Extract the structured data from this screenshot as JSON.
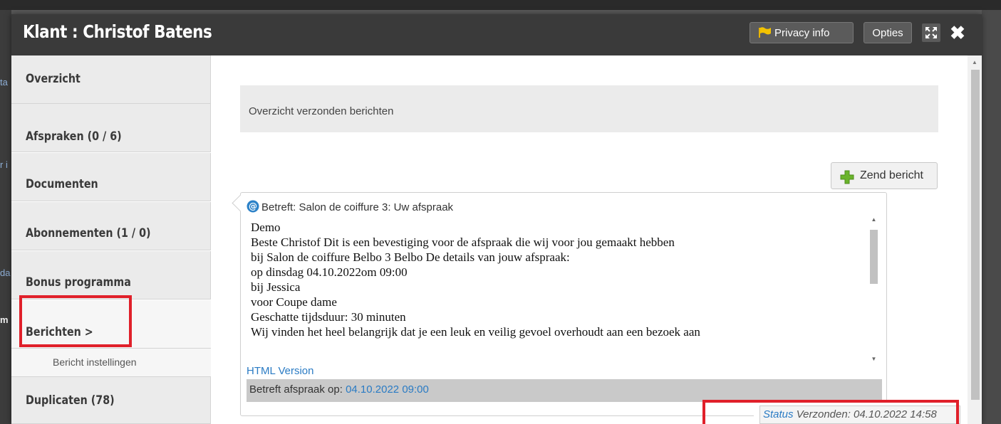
{
  "background": {
    "fragments": [
      "ta",
      "r i",
      "da",
      "m"
    ]
  },
  "modal": {
    "title": "Klant : Christof Batens",
    "privacy_label": "Privacy info",
    "options_label": "Opties",
    "close_glyph": "✖"
  },
  "sidebar": {
    "items": [
      {
        "label": "Overzicht"
      },
      {
        "label": "Afspraken (0 / 6)"
      },
      {
        "label": "Documenten"
      },
      {
        "label": "Abonnementen (1 / 0)"
      },
      {
        "label": "Bonus programma"
      },
      {
        "label": "Berichten >"
      },
      {
        "label": "Duplicaten (78)"
      }
    ],
    "sub_item": "Bericht instellingen",
    "active_index": 5
  },
  "content": {
    "section_title": "Overzicht verzonden berichten",
    "send_button_label": "Zend bericht",
    "message": {
      "subject": "Betreft: Salon de coiffure 3: Uw afspraak",
      "body_lines": [
        "Demo",
        "Beste Christof Dit is een bevestiging voor de afspraak die wij voor jou gemaakt hebben",
        "bij Salon de coiffure Belbo 3 Belbo De details van jouw afspraak:",
        "op dinsdag 04.10.2022om 09:00",
        "bij Jessica",
        "voor Coupe dame",
        "Geschatte tijdsduur: 30 minuten",
        "Wij vinden het heel belangrijk dat je een leuk en veilig gevoel overhoudt aan een bezoek aan"
      ],
      "html_link": "HTML Version",
      "appointment_label": "Betreft afspraak op:",
      "appointment_date": "04.10.2022 09:00",
      "status_link": "Status",
      "status_text": "Verzonden: 04.10.2022 14:58"
    }
  },
  "colors": {
    "header_bg": "#3a3a3a",
    "highlight": "#e0202a",
    "link": "#2a7bc4",
    "sidebar_bg": "#ebebeb"
  },
  "icons": [
    "flag-icon",
    "expand-icon",
    "close-icon",
    "plus-icon",
    "at-icon",
    "chevron-right-icon"
  ]
}
